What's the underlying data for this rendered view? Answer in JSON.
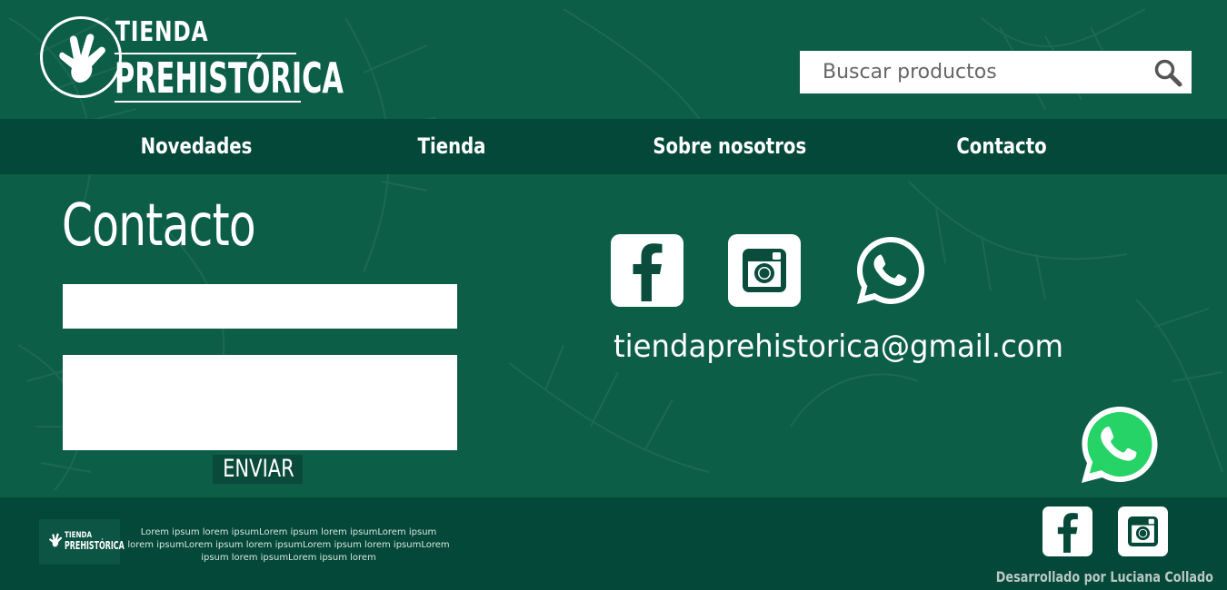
{
  "header": {
    "logo_line1": "TIENDA",
    "logo_line2": "PREHISTÓRICA",
    "search_placeholder": "Buscar productos",
    "search_icon": "search-icon"
  },
  "nav": {
    "items": [
      {
        "label": "Novedades"
      },
      {
        "label": "Tienda"
      },
      {
        "label": "Sobre nosotros"
      },
      {
        "label": "Contacto"
      }
    ]
  },
  "contact": {
    "title": "Contacto",
    "name_value": "",
    "message_value": "",
    "send_label": "ENVIAR",
    "email": "tiendaprehistorica@gmail.com",
    "socials": [
      "facebook-icon",
      "instagram-icon",
      "whatsapp-icon"
    ]
  },
  "footer": {
    "logo_line1": "TIENDA",
    "logo_line2": "PREHISTÓRICA",
    "text": "Lorem ipsum lorem ipsumLorem ipsum lorem ipsumLorem ipsum lorem ipsumLorem ipsum lorem ipsumLorem ipsum lorem ipsumLorem ipsum lorem ipsumLorem ipsum lorem",
    "credit": "Desarrollado por Luciana Collado",
    "socials": [
      "facebook-icon",
      "instagram-icon"
    ]
  },
  "colors": {
    "background": "#0d5e47",
    "nav": "#044839",
    "text": "#ffffff",
    "whatsapp": "#25d366"
  }
}
